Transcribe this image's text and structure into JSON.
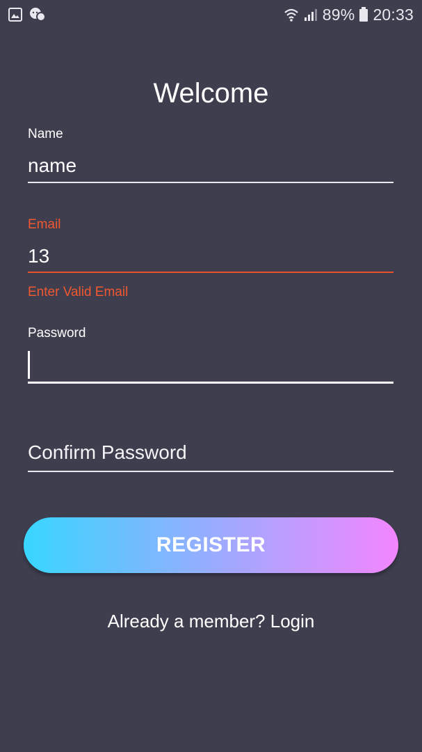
{
  "status_bar": {
    "left_icons": [
      "image-icon",
      "chat-notification-icon"
    ],
    "right_icons": [
      "wifi-icon",
      "signal-icon",
      "battery-icon"
    ],
    "battery": "89%",
    "time": "20:33"
  },
  "title": "Welcome",
  "form": {
    "name": {
      "label": "Name",
      "value": "name"
    },
    "email": {
      "label": "Email",
      "value": "13",
      "error": "Enter Valid Email",
      "error_color": "#f1582f"
    },
    "password": {
      "label": "Password",
      "value": ""
    },
    "confirm_password": {
      "placeholder": "Confirm Password"
    }
  },
  "register_button": {
    "label": "REGISTER",
    "gradient": [
      "#38d6ff",
      "#f386ff"
    ]
  },
  "login_link": "Already a member? Login",
  "colors": {
    "background": "#3f3e4f",
    "error": "#f1582f"
  }
}
